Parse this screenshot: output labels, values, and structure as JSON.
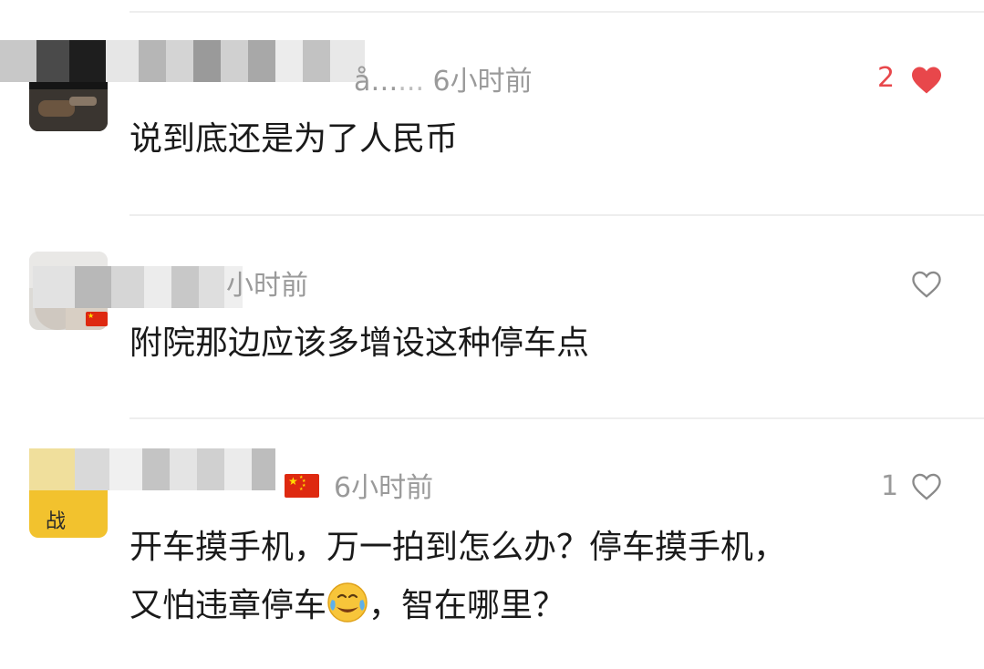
{
  "comments": [
    {
      "user_name_fragment": "å…",
      "time": "6小时前",
      "text": "说到底还是为了人民币",
      "like_count": "2",
      "liked": true
    },
    {
      "time": "小时前",
      "text": "附院那边应该多增设这种停车点",
      "like_count": "",
      "liked": false,
      "has_flag_badge": true
    },
    {
      "time": "6小时前",
      "text_line1": "开车摸手机，万一拍到怎么办？停车摸手机，",
      "text_line2_before": "又怕违章停车",
      "text_line2_after": "，智在哪里？",
      "emoji": "face-with-tears-of-joy",
      "like_count": "1",
      "liked": false,
      "has_flag": true,
      "avatar_text": "战"
    }
  ],
  "colors": {
    "liked": "#e8474b",
    "meta": "#9a9a9a",
    "text": "#1a1a1a",
    "divider": "#eeeeee"
  }
}
